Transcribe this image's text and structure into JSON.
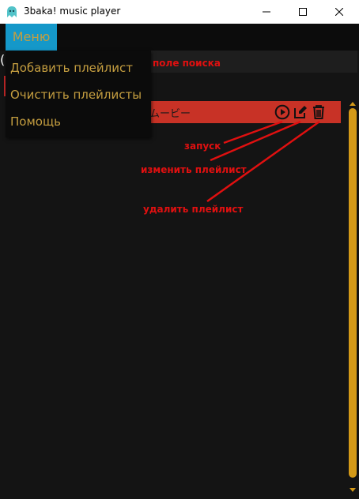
{
  "window": {
    "title": "3baka! music player",
    "icon": "app-icon",
    "controls": [
      "minimize-icon",
      "maximize-icon",
      "close-icon"
    ]
  },
  "menu": {
    "button_label": "Меню",
    "items": [
      {
        "label": "Добавить плейлист"
      },
      {
        "label": "Очистить плейлисты"
      },
      {
        "label": "Помощь"
      }
    ]
  },
  "search": {
    "partial_glyph": "("
  },
  "playlist": {
    "name_partial": "ムービー",
    "icons": [
      "play-circle-icon",
      "edit-icon",
      "trash-icon"
    ]
  },
  "annotations": {
    "search_field": "поле поиска",
    "launch": "запуск",
    "edit": "изменить плейлист",
    "delete": "удалить плейлист"
  },
  "colors": {
    "menu_button_bg": "#1598c9",
    "menu_text": "#c59e40",
    "playlist_bg": "#c83226",
    "scrollbar": "#d49a18",
    "annotation": "#e01010",
    "background": "#141414"
  }
}
